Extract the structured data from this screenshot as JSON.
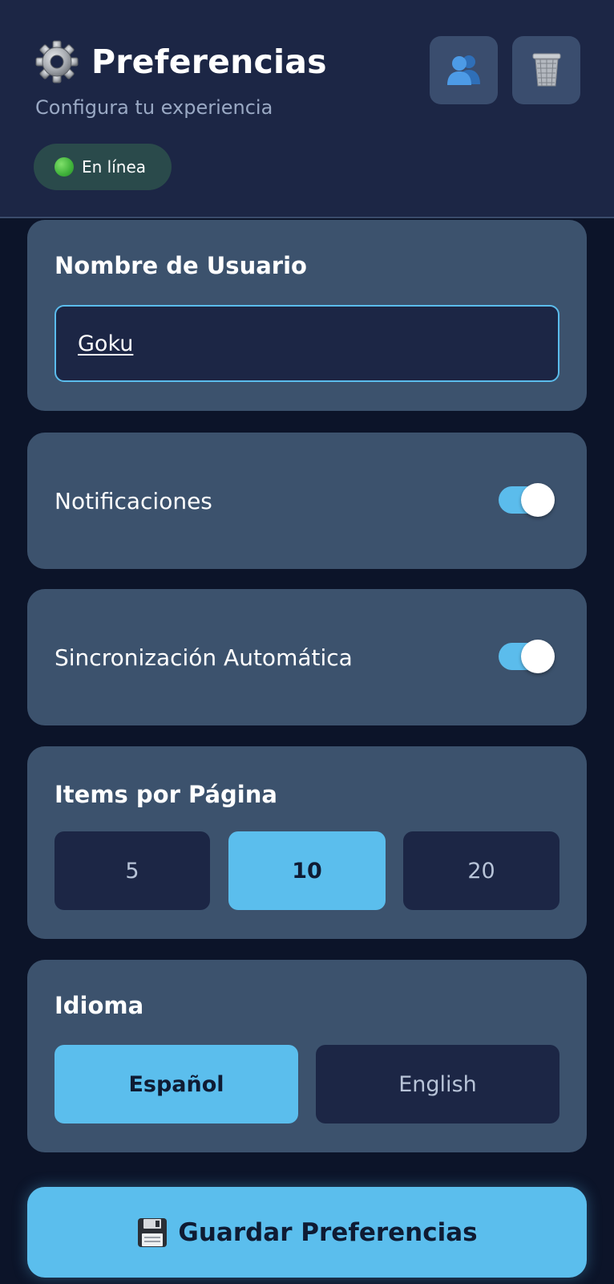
{
  "header": {
    "title": "Preferencias",
    "subtitle": "Configura tu experiencia",
    "title_icon": "gear-icon",
    "status": {
      "text": "En línea",
      "icon": "green-circle-icon",
      "color": "#3fb13a"
    },
    "actions": [
      {
        "name": "users-button",
        "icon": "users-icon"
      },
      {
        "name": "trash-button",
        "icon": "trash-icon"
      }
    ]
  },
  "username": {
    "label": "Nombre de Usuario",
    "value": "Goku"
  },
  "notifications": {
    "label": "Notificaciones",
    "enabled": true
  },
  "auto_sync": {
    "label": "Sincronización Automática",
    "enabled": true
  },
  "items_per_page": {
    "label": "Items por Página",
    "options": [
      "5",
      "10",
      "20"
    ],
    "selected": "10"
  },
  "language": {
    "label": "Idioma",
    "options": [
      "Español",
      "English"
    ],
    "selected": "Español"
  },
  "save": {
    "label": "Guardar Preferencias",
    "icon": "floppy-disk-icon"
  },
  "colors": {
    "background": "#0c1429",
    "header": "#1c2645",
    "card": "#3c526d",
    "accent": "#5bbeed",
    "input_bg": "#1c2645"
  }
}
